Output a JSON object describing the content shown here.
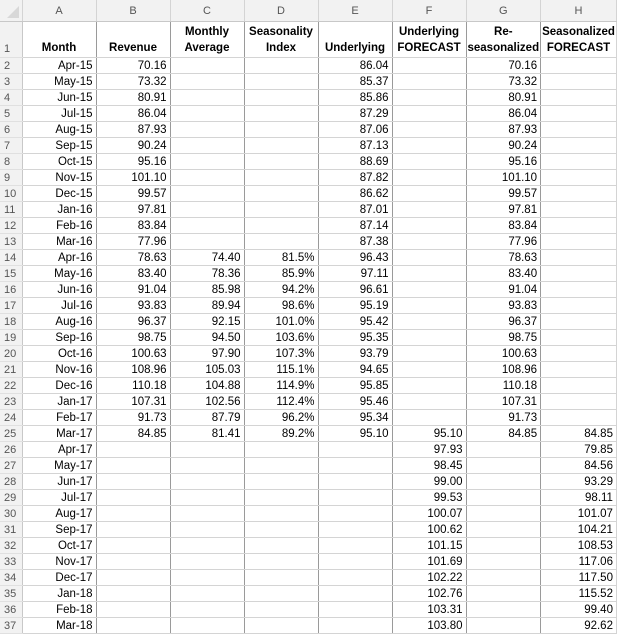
{
  "app": "Spreadsheet",
  "column_letters": [
    "A",
    "B",
    "C",
    "D",
    "E",
    "F",
    "G",
    "H"
  ],
  "header_row": {
    "row_number": "1",
    "cells": [
      [
        "Month"
      ],
      [
        "Revenue"
      ],
      [
        "Monthly",
        "Average"
      ],
      [
        "Seasonality",
        "Index"
      ],
      [
        "Underlying"
      ],
      [
        "Underlying",
        "FORECAST"
      ],
      [
        "Re-",
        "seasonalized"
      ],
      [
        "Seasonalized",
        "FORECAST"
      ]
    ],
    "labels": [
      "Month",
      "Revenue",
      "Monthly Average",
      "Seasonality Index",
      "Underlying",
      "Underlying FORECAST",
      "Re-seasonalized",
      "Seasonalized FORECAST"
    ]
  },
  "rows": [
    {
      "n": "2",
      "cells": [
        "Apr-15",
        "70.16",
        "",
        "",
        "86.04",
        "",
        "70.16",
        ""
      ]
    },
    {
      "n": "3",
      "cells": [
        "May-15",
        "73.32",
        "",
        "",
        "85.37",
        "",
        "73.32",
        ""
      ]
    },
    {
      "n": "4",
      "cells": [
        "Jun-15",
        "80.91",
        "",
        "",
        "85.86",
        "",
        "80.91",
        ""
      ]
    },
    {
      "n": "5",
      "cells": [
        "Jul-15",
        "86.04",
        "",
        "",
        "87.29",
        "",
        "86.04",
        ""
      ]
    },
    {
      "n": "6",
      "cells": [
        "Aug-15",
        "87.93",
        "",
        "",
        "87.06",
        "",
        "87.93",
        ""
      ]
    },
    {
      "n": "7",
      "cells": [
        "Sep-15",
        "90.24",
        "",
        "",
        "87.13",
        "",
        "90.24",
        ""
      ]
    },
    {
      "n": "8",
      "cells": [
        "Oct-15",
        "95.16",
        "",
        "",
        "88.69",
        "",
        "95.16",
        ""
      ]
    },
    {
      "n": "9",
      "cells": [
        "Nov-15",
        "101.10",
        "",
        "",
        "87.82",
        "",
        "101.10",
        ""
      ]
    },
    {
      "n": "10",
      "cells": [
        "Dec-15",
        "99.57",
        "",
        "",
        "86.62",
        "",
        "99.57",
        ""
      ]
    },
    {
      "n": "11",
      "cells": [
        "Jan-16",
        "97.81",
        "",
        "",
        "87.01",
        "",
        "97.81",
        ""
      ]
    },
    {
      "n": "12",
      "cells": [
        "Feb-16",
        "83.84",
        "",
        "",
        "87.14",
        "",
        "83.84",
        ""
      ]
    },
    {
      "n": "13",
      "cells": [
        "Mar-16",
        "77.96",
        "",
        "",
        "87.38",
        "",
        "77.96",
        ""
      ]
    },
    {
      "n": "14",
      "cells": [
        "Apr-16",
        "78.63",
        "74.40",
        "81.5%",
        "96.43",
        "",
        "78.63",
        ""
      ]
    },
    {
      "n": "15",
      "cells": [
        "May-16",
        "83.40",
        "78.36",
        "85.9%",
        "97.11",
        "",
        "83.40",
        ""
      ]
    },
    {
      "n": "16",
      "cells": [
        "Jun-16",
        "91.04",
        "85.98",
        "94.2%",
        "96.61",
        "",
        "91.04",
        ""
      ]
    },
    {
      "n": "17",
      "cells": [
        "Jul-16",
        "93.83",
        "89.94",
        "98.6%",
        "95.19",
        "",
        "93.83",
        ""
      ]
    },
    {
      "n": "18",
      "cells": [
        "Aug-16",
        "96.37",
        "92.15",
        "101.0%",
        "95.42",
        "",
        "96.37",
        ""
      ]
    },
    {
      "n": "19",
      "cells": [
        "Sep-16",
        "98.75",
        "94.50",
        "103.6%",
        "95.35",
        "",
        "98.75",
        ""
      ]
    },
    {
      "n": "20",
      "cells": [
        "Oct-16",
        "100.63",
        "97.90",
        "107.3%",
        "93.79",
        "",
        "100.63",
        ""
      ]
    },
    {
      "n": "21",
      "cells": [
        "Nov-16",
        "108.96",
        "105.03",
        "115.1%",
        "94.65",
        "",
        "108.96",
        ""
      ]
    },
    {
      "n": "22",
      "cells": [
        "Dec-16",
        "110.18",
        "104.88",
        "114.9%",
        "95.85",
        "",
        "110.18",
        ""
      ]
    },
    {
      "n": "23",
      "cells": [
        "Jan-17",
        "107.31",
        "102.56",
        "112.4%",
        "95.46",
        "",
        "107.31",
        ""
      ]
    },
    {
      "n": "24",
      "cells": [
        "Feb-17",
        "91.73",
        "87.79",
        "96.2%",
        "95.34",
        "",
        "91.73",
        ""
      ]
    },
    {
      "n": "25",
      "cells": [
        "Mar-17",
        "84.85",
        "81.41",
        "89.2%",
        "95.10",
        "95.10",
        "84.85",
        "84.85"
      ]
    },
    {
      "n": "26",
      "cells": [
        "Apr-17",
        "",
        "",
        "",
        "",
        "97.93",
        "",
        "79.85"
      ]
    },
    {
      "n": "27",
      "cells": [
        "May-17",
        "",
        "",
        "",
        "",
        "98.45",
        "",
        "84.56"
      ]
    },
    {
      "n": "28",
      "cells": [
        "Jun-17",
        "",
        "",
        "",
        "",
        "99.00",
        "",
        "93.29"
      ]
    },
    {
      "n": "29",
      "cells": [
        "Jul-17",
        "",
        "",
        "",
        "",
        "99.53",
        "",
        "98.11"
      ]
    },
    {
      "n": "30",
      "cells": [
        "Aug-17",
        "",
        "",
        "",
        "",
        "100.07",
        "",
        "101.07"
      ]
    },
    {
      "n": "31",
      "cells": [
        "Sep-17",
        "",
        "",
        "",
        "",
        "100.62",
        "",
        "104.21"
      ]
    },
    {
      "n": "32",
      "cells": [
        "Oct-17",
        "",
        "",
        "",
        "",
        "101.15",
        "",
        "108.53"
      ]
    },
    {
      "n": "33",
      "cells": [
        "Nov-17",
        "",
        "",
        "",
        "",
        "101.69",
        "",
        "117.06"
      ]
    },
    {
      "n": "34",
      "cells": [
        "Dec-17",
        "",
        "",
        "",
        "",
        "102.22",
        "",
        "117.50"
      ]
    },
    {
      "n": "35",
      "cells": [
        "Jan-18",
        "",
        "",
        "",
        "",
        "102.76",
        "",
        "115.52"
      ]
    },
    {
      "n": "36",
      "cells": [
        "Feb-18",
        "",
        "",
        "",
        "",
        "103.31",
        "",
        "99.40"
      ]
    },
    {
      "n": "37",
      "cells": [
        "Mar-18",
        "",
        "",
        "",
        "",
        "103.80",
        "",
        "92.62"
      ]
    }
  ],
  "colors": {
    "header_bg": "#f2f2f2",
    "gridline": "#d4d4d4",
    "text": "#000000",
    "header_text": "#555555"
  }
}
